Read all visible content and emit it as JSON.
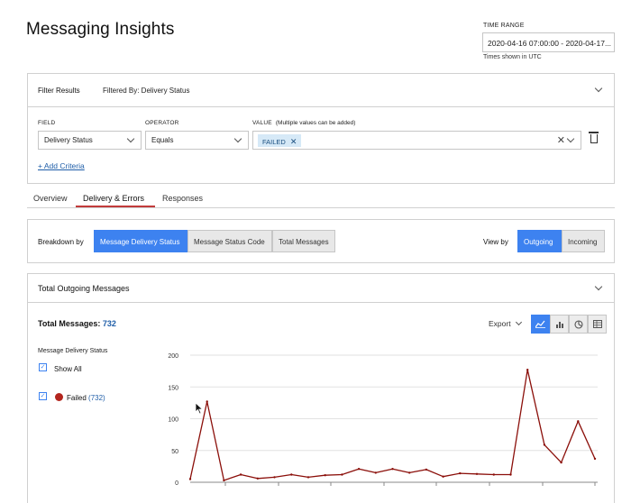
{
  "page": {
    "title": "Messaging Insights"
  },
  "time_range": {
    "label": "TIME RANGE",
    "value": "2020-04-16 07:00:00 - 2020-04-17...",
    "note": "Times shown in UTC"
  },
  "filter": {
    "title": "Filter Results",
    "filtered_by": "Filtered By: Delivery Status",
    "field_label": "FIELD",
    "field_value": "Delivery Status",
    "operator_label": "OPERATOR",
    "operator_value": "Equals",
    "value_label": "VALUE",
    "value_hint": "(Multiple values can be added)",
    "value_chip": "FAILED",
    "add_criteria": "+ Add Criteria"
  },
  "tabs": [
    {
      "label": "Overview"
    },
    {
      "label": "Delivery & Errors",
      "active": true
    },
    {
      "label": "Responses"
    }
  ],
  "breakdown": {
    "label": "Breakdown by",
    "options": [
      "Message Delivery Status",
      "Message Status Code",
      "Total Messages"
    ],
    "selected": "Message Delivery Status",
    "view_by_label": "View by",
    "view_by_options": [
      "Outgoing",
      "Incoming"
    ],
    "view_by_selected": "Outgoing"
  },
  "chart_panel": {
    "title": "Total Outgoing Messages",
    "total_label": "Total Messages:",
    "total_value": "732",
    "export_label": "Export",
    "view_icons": [
      "line-chart-icon",
      "bar-chart-icon",
      "pie-chart-icon",
      "table-icon"
    ],
    "legend_title": "Message Delivery Status",
    "show_all": "Show All",
    "legend_item": {
      "name": "Failed",
      "count": "(732)",
      "color": "#b3261e"
    }
  },
  "chart_data": {
    "type": "line",
    "yticks": [
      0,
      50,
      100,
      150,
      200
    ],
    "ylim": [
      0,
      200
    ],
    "series": [
      {
        "name": "Failed",
        "color": "#8b0f0a",
        "values": [
          5,
          127,
          3,
          12,
          6,
          8,
          12,
          8,
          11,
          12,
          21,
          15,
          21,
          15,
          20,
          9,
          14,
          13,
          12,
          12,
          177,
          59,
          31,
          96,
          37
        ]
      }
    ]
  }
}
